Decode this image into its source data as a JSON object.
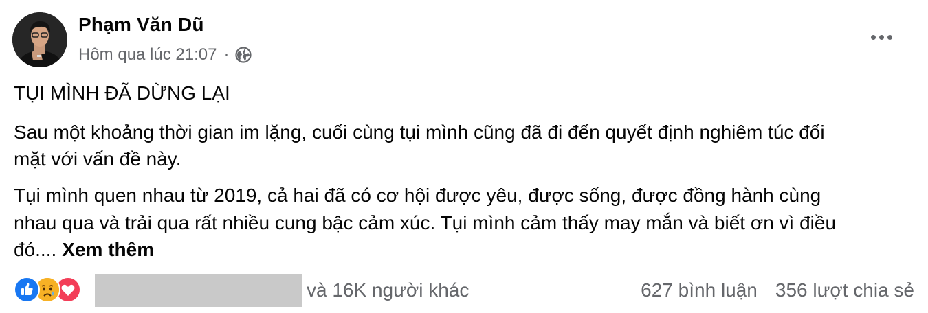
{
  "post": {
    "author": {
      "name": "Phạm Văn Dũ",
      "avatar_icon": "profile-photo"
    },
    "meta": {
      "timestamp": "Hôm qua lúc 21:07",
      "separator": "·",
      "audience_icon": "globe-icon"
    },
    "menu_icon": "more-options-icon",
    "content": {
      "title": "TỤI MÌNH ĐÃ DỪNG LẠI",
      "paragraph1": [
        "Sau một khoảng thời gian im lặng, cuối cùng tụi mình cũng đã đi đến quyết định nghiêm túc đối",
        "mặt với vấn đề này."
      ],
      "paragraph2": [
        "Tụi mình quen nhau từ 2019, cả hai đã có cơ hội được yêu, được sống, được đồng hành cùng",
        "nhau qua và trải qua rất nhiều cung bậc cảm xúc. Tụi mình cảm thấy may mắn và biết ơn vì điều",
        "đó...."
      ],
      "see_more": "Xem thêm"
    },
    "engagement": {
      "reaction_icons": [
        "like-icon",
        "care-icon",
        "love-icon"
      ],
      "reactors_suffix": "và 16K người khác",
      "comments": "627 bình luận",
      "shares": "356 lượt chia sẻ"
    },
    "colors": {
      "like": "#1877f2",
      "love": "#f33e58",
      "care": "#f7b125",
      "secondary_text": "#65676b",
      "redaction": "#c9c9c9"
    }
  }
}
